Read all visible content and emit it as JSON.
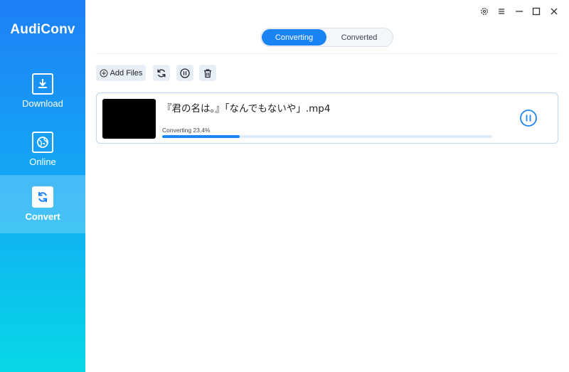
{
  "app": {
    "name": "AudiConv"
  },
  "sidebar": {
    "items": [
      {
        "label": "Download",
        "icon": "download-icon"
      },
      {
        "label": "Online",
        "icon": "globe-icon"
      },
      {
        "label": "Convert",
        "icon": "convert-icon",
        "active": true
      }
    ]
  },
  "window_controls": [
    "settings-icon",
    "menu-icon",
    "minimize-icon",
    "maximize-icon",
    "close-icon"
  ],
  "tabs": {
    "converting": "Converting",
    "converted": "Converted",
    "active": "converting"
  },
  "toolbar": {
    "add_files": "Add Files",
    "buttons": [
      "refresh-icon",
      "pause-all-icon",
      "delete-icon"
    ]
  },
  "task": {
    "filename": "『君の名は。』「なんでもないや」.mp4",
    "status": "Converting 23.4%",
    "progress_percent": 23.4
  },
  "colors": {
    "accent": "#1a84f5",
    "sidebar_top": "#1e7ff5",
    "sidebar_bottom": "#07d8e6"
  }
}
